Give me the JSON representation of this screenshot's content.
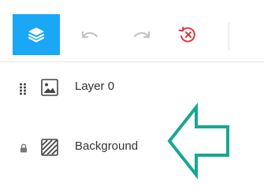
{
  "colors": {
    "accent": "#1aa7f5",
    "icon_disabled": "#c4c4c4",
    "clear_red": "#e0393e",
    "text": "#333333",
    "annotation_arrow": "#18a792"
  },
  "toolbar": {
    "layers_button": {
      "icon": "layers-icon",
      "active": true
    },
    "undo_button": {
      "icon": "undo-icon",
      "enabled": false
    },
    "redo_button": {
      "icon": "redo-icon",
      "enabled": false
    },
    "clear_button": {
      "icon": "clear-history-icon"
    }
  },
  "layers": [
    {
      "name": "Layer 0",
      "icon": "image-icon",
      "control": "drag-handle-icon"
    },
    {
      "name": "Background",
      "icon": "background-icon",
      "control": "lock-icon"
    }
  ],
  "annotation": {
    "icon": "arrow-left-icon"
  }
}
